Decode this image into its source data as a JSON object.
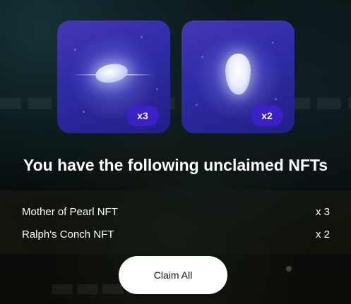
{
  "nfts": [
    {
      "name": "Mother of Pearl NFT",
      "qty": "x 3",
      "badge": "x3",
      "icon": "pearl-shell"
    },
    {
      "name": "Ralph's Conch NFT",
      "qty": "x 2",
      "badge": "x2",
      "icon": "conch-shell"
    }
  ],
  "modal": {
    "heading": "You have the following unclaimed NFTs",
    "claim_label": "Claim All"
  },
  "colors": {
    "card_bg": "#2f2ba6",
    "badge_bg": "#3b20c8",
    "button_bg": "#ffffff"
  }
}
